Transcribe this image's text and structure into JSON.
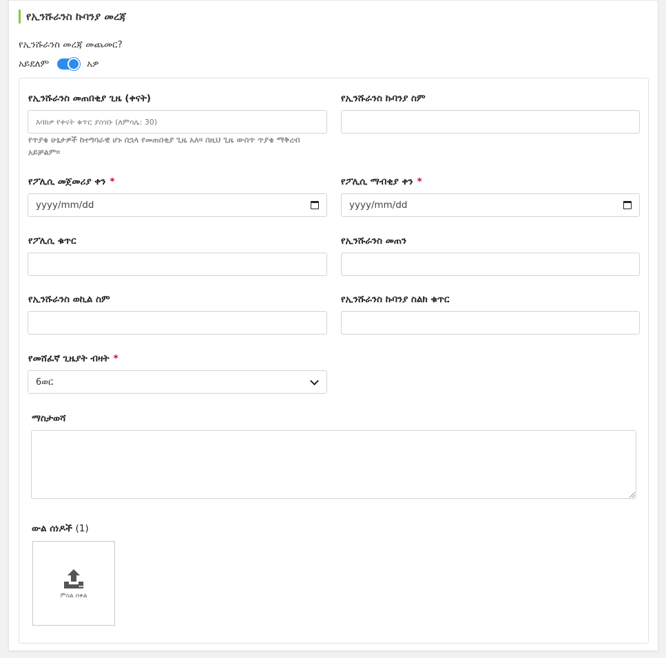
{
  "section": {
    "title": "የኢንሹራንስ ኩባንያ መረጃ"
  },
  "toggle": {
    "question": "የኢንሹራንስ መረጃ መጨመር?",
    "off_label": "አይደለም",
    "on_label": "አዎ",
    "state": "on"
  },
  "fields": {
    "grace_period": {
      "label": "የኢንሹራንስ መጠበቂያ ጊዜ (ቀናት)",
      "placeholder": "እባክዎ የቀናት ቁጥር ያስገቡ (ለምሳሌ: 30)",
      "value": "",
      "helper": "የጥያቄ ሁኔታዎች ከተግባራዊ ሆኑ በኋላ የመጠበቂያ ጊዜ አለ። በዚህ ጊዜ ውስጥ ጥያቄ ማቅረብ አይቻልም።"
    },
    "company_name": {
      "label": "የኢንሹራንስ ኩባንያ ስም",
      "value": ""
    },
    "policy_start": {
      "label": "የፖሊሲ መጀመሪያ ቀን",
      "required_mark": "*",
      "value": "yyyy/mm/dd"
    },
    "policy_end": {
      "label": "የፖሊሲ ማብቂያ ቀን",
      "required_mark": "*",
      "value": "yyyy/mm/dd"
    },
    "policy_number": {
      "label": "የፖሊሲ ቁጥር",
      "value": ""
    },
    "insurance_amount": {
      "label": "የኢንሹራንስ መጠን",
      "value": ""
    },
    "agent_name": {
      "label": "የኢንሹራንስ ወኪል ስም",
      "value": ""
    },
    "company_phone": {
      "label": "የኢንሹራንስ ኩባንያ ስልክ ቁጥር",
      "value": ""
    },
    "reminder_count": {
      "label": "የመሸፈኛ ጊዜያት ብዛት",
      "required_mark": "*",
      "selected": "6ወር"
    },
    "notes": {
      "label": "ማስታወሻ",
      "value": ""
    }
  },
  "attachments": {
    "label": "ውል ሰነዶች",
    "count": "(1)",
    "upload_caption": "ምስል ስቀል"
  },
  "colors": {
    "accent": "#8cc63f",
    "toggle": "#2d8cf0",
    "required": "#d9001b"
  }
}
